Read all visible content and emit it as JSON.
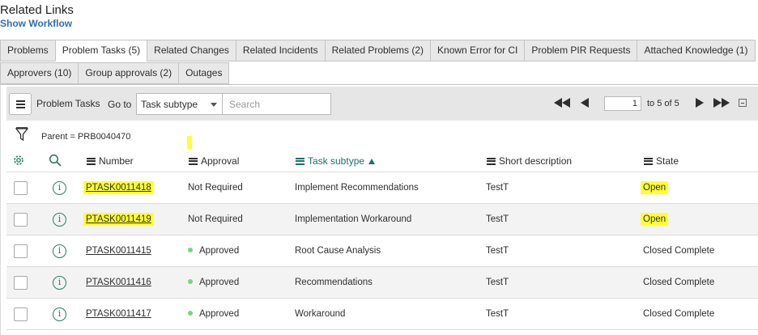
{
  "header": {
    "title": "Related Links",
    "show_workflow": "Show Workflow"
  },
  "tabs_row1": [
    {
      "label": "Problems"
    },
    {
      "label": "Problem Tasks (5)",
      "active": true
    },
    {
      "label": "Related Changes"
    },
    {
      "label": "Related Incidents"
    },
    {
      "label": "Related Problems (2)"
    },
    {
      "label": "Known Error for CI"
    },
    {
      "label": "Problem PIR Requests"
    },
    {
      "label": "Attached Knowledge (1)"
    }
  ],
  "tabs_row2": [
    {
      "label": "Approvers (10)"
    },
    {
      "label": "Group approvals (2)"
    },
    {
      "label": "Outages"
    }
  ],
  "toolbar": {
    "title": "Problem Tasks",
    "goto_label": "Go to",
    "goto_select": "Task subtype",
    "search_placeholder": "Search",
    "page_value": "1",
    "page_of": "to 5 of 5"
  },
  "filter": {
    "breadcrumb": "Parent = PRB0040470"
  },
  "columns": {
    "number": "Number",
    "approval": "Approval",
    "task_subtype": "Task subtype",
    "short_description": "Short description",
    "state": "State"
  },
  "rows": [
    {
      "number": "PTASK0011418",
      "approval": "Not Required",
      "task_subtype": "Implement Recommendations",
      "short_description": "TestT",
      "state": "Open"
    },
    {
      "number": "PTASK0011419",
      "approval": "Not Required",
      "task_subtype": "Implementation Workaround",
      "short_description": "TestT",
      "state": "Open"
    },
    {
      "number": "PTASK0011415",
      "approval": "Approved",
      "task_subtype": "Root Cause Analysis",
      "short_description": "TestT",
      "state": "Closed Complete"
    },
    {
      "number": "PTASK0011416",
      "approval": "Approved",
      "task_subtype": "Recommendations",
      "short_description": "TestT",
      "state": "Closed Complete"
    },
    {
      "number": "PTASK0011417",
      "approval": "Approved",
      "task_subtype": "Workaround",
      "short_description": "TestT",
      "state": "Closed Complete"
    }
  ],
  "colors": {
    "highlight": "#ffff33",
    "approved_dot": "#7fd08a",
    "link": "#2f6fb3",
    "sorted": "#1f6f6b"
  },
  "icons": [
    "menu-icon",
    "first-page-icon",
    "previous-page-icon",
    "next-page-icon",
    "last-page-icon",
    "collapse-icon",
    "filter-icon",
    "gear-icon",
    "search-icon",
    "info-icon",
    "sort-ascending-icon"
  ]
}
